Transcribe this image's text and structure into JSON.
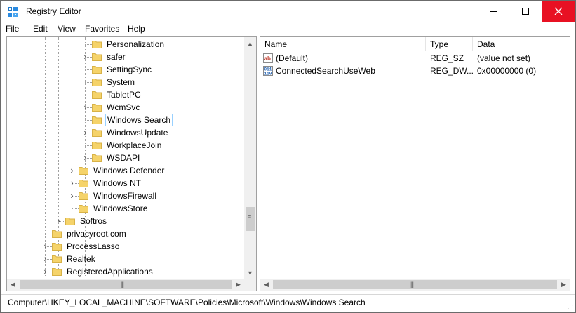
{
  "window": {
    "title": "Registry Editor",
    "controls": {
      "minimize": "minimize",
      "maximize": "maximize",
      "close": "close"
    }
  },
  "menu": [
    "File",
    "Edit",
    "View",
    "Favorites",
    "Help"
  ],
  "tree": {
    "items": [
      {
        "label": "Personalization",
        "level": 3,
        "expandable": false,
        "selected": false
      },
      {
        "label": "safer",
        "level": 3,
        "expandable": true,
        "selected": false
      },
      {
        "label": "SettingSync",
        "level": 3,
        "expandable": false,
        "selected": false
      },
      {
        "label": "System",
        "level": 3,
        "expandable": false,
        "selected": false
      },
      {
        "label": "TabletPC",
        "level": 3,
        "expandable": false,
        "selected": false
      },
      {
        "label": "WcmSvc",
        "level": 3,
        "expandable": true,
        "selected": false
      },
      {
        "label": "Windows Search",
        "level": 3,
        "expandable": false,
        "selected": true
      },
      {
        "label": "WindowsUpdate",
        "level": 3,
        "expandable": true,
        "selected": false
      },
      {
        "label": "WorkplaceJoin",
        "level": 3,
        "expandable": false,
        "selected": false
      },
      {
        "label": "WSDAPI",
        "level": 3,
        "expandable": true,
        "selected": false
      },
      {
        "label": "Windows Defender",
        "level": 2,
        "expandable": true,
        "selected": false
      },
      {
        "label": "Windows NT",
        "level": 2,
        "expandable": true,
        "selected": false
      },
      {
        "label": "WindowsFirewall",
        "level": 2,
        "expandable": true,
        "selected": false
      },
      {
        "label": "WindowsStore",
        "level": 2,
        "expandable": false,
        "selected": false
      },
      {
        "label": "Softros",
        "level": 1,
        "expandable": true,
        "selected": false
      },
      {
        "label": "privacyroot.com",
        "level": 0,
        "expandable": false,
        "selected": false
      },
      {
        "label": "ProcessLasso",
        "level": 0,
        "expandable": true,
        "selected": false
      },
      {
        "label": "Realtek",
        "level": 0,
        "expandable": true,
        "selected": false
      },
      {
        "label": "RegisteredApplications",
        "level": 0,
        "expandable": true,
        "selected": false
      }
    ]
  },
  "list": {
    "columns": {
      "name": "Name",
      "type": "Type",
      "data": "Data"
    },
    "rows": [
      {
        "icon": "string-value-icon",
        "name": "(Default)",
        "type": "REG_SZ",
        "data": "(value not set)"
      },
      {
        "icon": "dword-value-icon",
        "name": "ConnectedSearchUseWeb",
        "type": "REG_DW...",
        "data": "0x00000000 (0)"
      }
    ]
  },
  "scroll": {
    "up_arrow": "▲",
    "down_arrow": "▼",
    "left_arrow": "◀",
    "right_arrow": "▶",
    "grip_vertical": "≡",
    "grip_horizontal": "|||"
  },
  "status": {
    "path": "Computer\\HKEY_LOCAL_MACHINE\\SOFTWARE\\Policies\\Microsoft\\Windows\\Windows Search"
  },
  "colors": {
    "close_button": "#e81123",
    "folder": "#f5d36a",
    "selection_border": "#99d1ff"
  }
}
